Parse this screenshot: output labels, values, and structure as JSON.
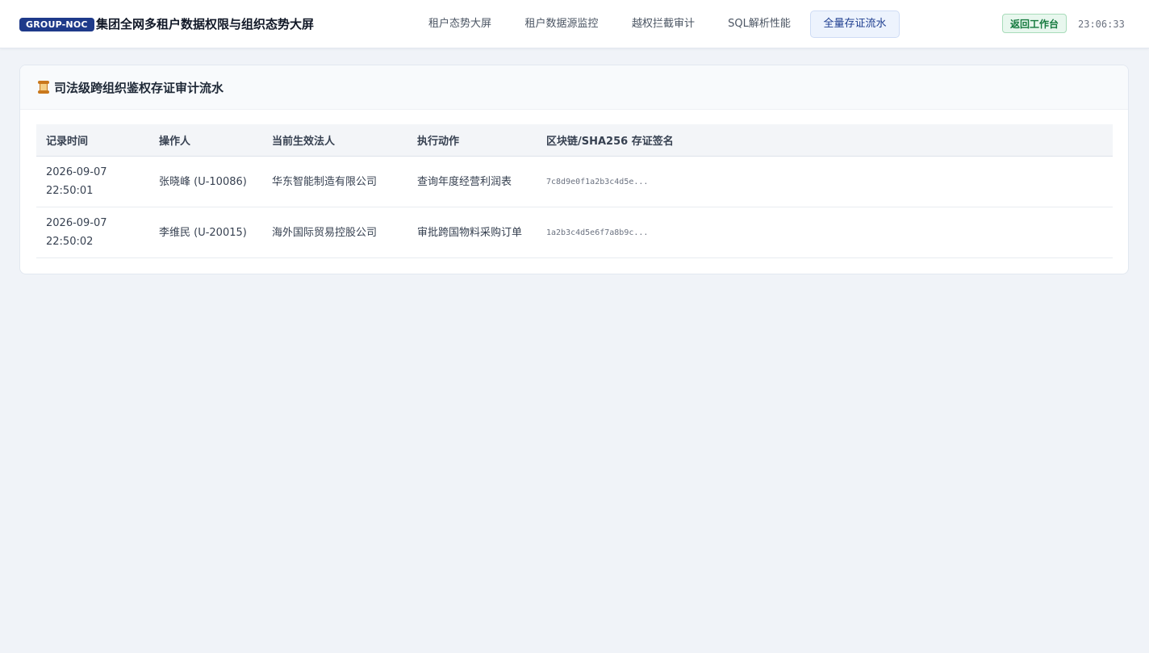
{
  "header": {
    "badge": "GROUP-NOC",
    "title": "集团全网多租户数据权限与组织态势大屏",
    "tabs": [
      {
        "label": "租户态势大屏",
        "active": false
      },
      {
        "label": "租户数据源监控",
        "active": false
      },
      {
        "label": "越权拦截审计",
        "active": false
      },
      {
        "label": "SQL解析性能",
        "active": false
      },
      {
        "label": "全量存证流水",
        "active": true
      }
    ],
    "back_button": "返回工作台",
    "clock": "23:06:33"
  },
  "card": {
    "icon": "scroll-icon",
    "title": "司法级跨组织鉴权存证审计流水"
  },
  "table": {
    "columns": [
      "记录时间",
      "操作人",
      "当前生效法人",
      "执行动作",
      "区块链/SHA256 存证签名"
    ],
    "rows": [
      {
        "date": "2026-09-07",
        "time": "22:50:01",
        "operator": "张晓峰 (U-10086)",
        "entity": "华东智能制造有限公司",
        "action": "查询年度经营利润表",
        "signature": "7c8d9e0f1a2b3c4d5e..."
      },
      {
        "date": "2026-09-07",
        "time": "22:50:02",
        "operator": "李维民 (U-20015)",
        "entity": "海外国际贸易控股公司",
        "action": "审批跨国物料采购订单",
        "signature": "1a2b3c4d5e6f7a8b9c..."
      }
    ]
  },
  "colors": {
    "brand": "#1e3a8a",
    "active_tab_bg": "#edf3fd",
    "success": "#157a3e",
    "page_bg": "#f0f3f8"
  }
}
